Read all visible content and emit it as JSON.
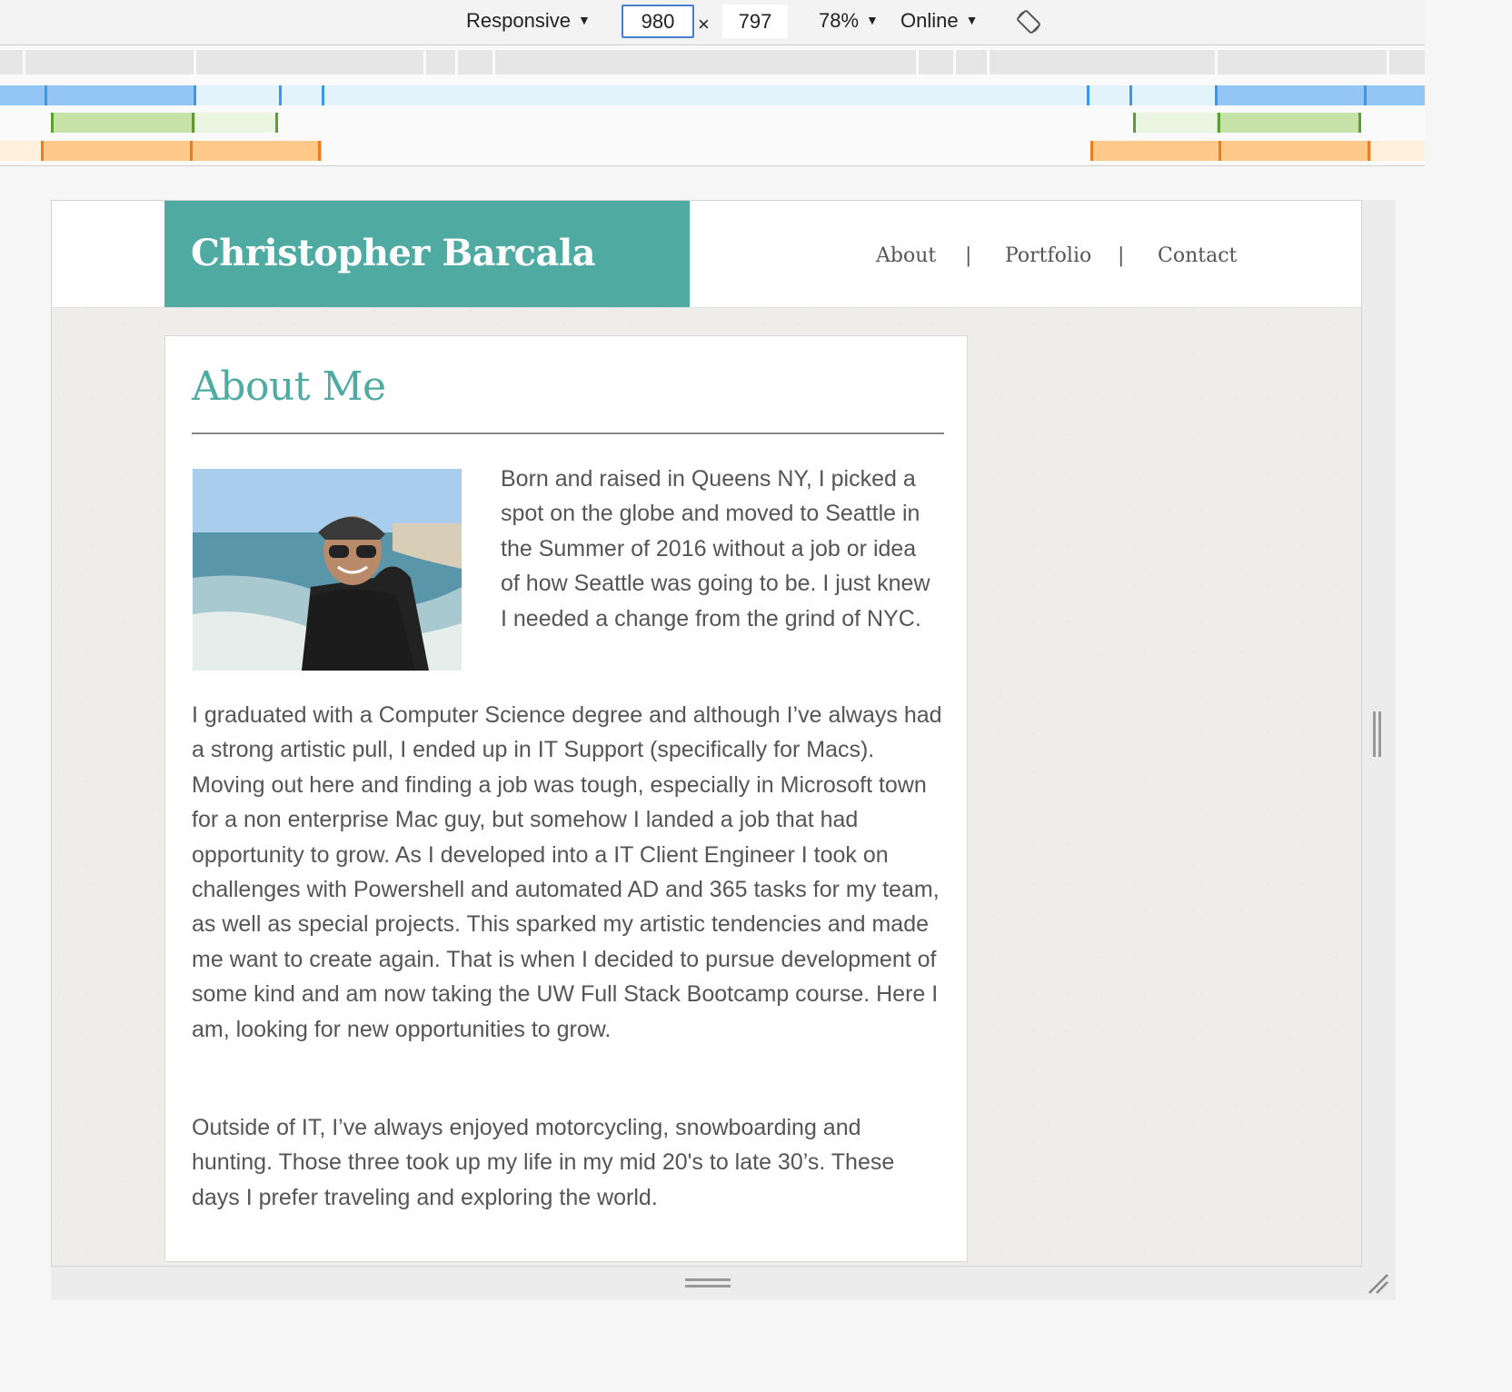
{
  "devtools": {
    "device": "Responsive",
    "width": "980",
    "height": "797",
    "times": "×",
    "zoom": "78%",
    "network": "Online",
    "caret": "▼"
  },
  "site": {
    "brand": "Christopher Barcala",
    "nav": {
      "about": "About",
      "separator": "|",
      "portfolio": "Portfolio",
      "contact": "Contact"
    },
    "accent_color": "#4faaa2",
    "about": {
      "heading": "About Me",
      "intro": "Born and raised in Queens NY, I picked a spot on the globe and moved to Seattle in the Summer of 2016 without a job or idea of how Seattle was going to be. I just knew I needed a change from the grind of NYC.",
      "career": "I graduated with a Computer Science degree and although I’ve always had a strong artistic pull, I ended up in IT Support (specifically for Macs). Moving out here and finding a job was tough, especially in Microsoft town for a non enterprise Mac guy, but somehow I landed a job that had opportunity to grow. As I developed into a IT Client Engineer I took on challenges with Powershell and automated AD and 365 tasks for my team, as well as special projects. This sparked my artistic tendencies and made me want to create again. That is when I decided to pursue development of some kind and am now taking the UW Full Stack Bootcamp course. Here I am, looking for new opportunities to grow.",
      "hobbies": "Outside of IT, I’ve always enjoyed motorcycling, snowboarding and hunting. Those three took up my life in my mid 20's to late 30’s. These days I prefer traveling and exploring the world."
    }
  }
}
